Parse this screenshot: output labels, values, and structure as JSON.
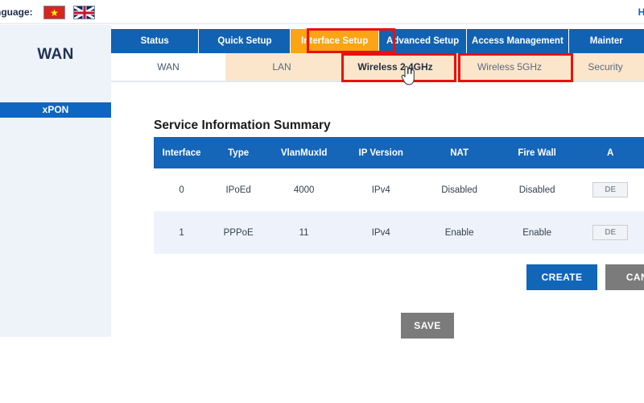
{
  "topbar": {
    "language_label": "nguage:",
    "flags": [
      {
        "name": "vietnam-flag",
        "title": "Vietnamese"
      },
      {
        "name": "uk-flag",
        "title": "English"
      }
    ],
    "help_label": "He"
  },
  "sidebar": {
    "title": "WAN",
    "items": [
      {
        "label": "xPON",
        "active": true
      }
    ]
  },
  "nav": {
    "tabs": [
      {
        "label": "Status",
        "active": false
      },
      {
        "label": "Quick Setup",
        "active": false
      },
      {
        "label": "Interface Setup",
        "active": true
      },
      {
        "label": "Advanced Setup",
        "active": false
      },
      {
        "label": "Access Management",
        "active": false
      },
      {
        "label": "Mainter",
        "active": false
      }
    ]
  },
  "subnav": {
    "tabs": [
      {
        "label": "WAN",
        "active": true
      },
      {
        "label": "LAN",
        "active": false
      },
      {
        "label": "Wireless 2.4GHz",
        "active": false,
        "highlighted": true
      },
      {
        "label": "Wireless 5GHz",
        "active": false,
        "highlighted": true
      },
      {
        "label": "Security",
        "active": false
      }
    ]
  },
  "content": {
    "section_title": "Service Information Summary",
    "table": {
      "columns": [
        "Interface",
        "Type",
        "VlanMuxId",
        "IP Version",
        "NAT",
        "Fire Wall",
        "A"
      ],
      "rows": [
        {
          "interface": "0",
          "type": "IPoEd",
          "vlanmuxid": "4000",
          "ip_version": "IPv4",
          "nat": "Disabled",
          "firewall": "Disabled",
          "action_label": "DE"
        },
        {
          "interface": "1",
          "type": "PPPoE",
          "vlanmuxid": "11",
          "ip_version": "IPv4",
          "nat": "Enable",
          "firewall": "Enable",
          "action_label": "DE"
        }
      ]
    },
    "buttons": {
      "create": "CREATE",
      "cancel": "CANC",
      "save": "SAVE"
    }
  },
  "colors": {
    "nav_blue": "#1262b3",
    "active_orange": "#fba415",
    "annotation_red": "#e8110d",
    "table_header_blue": "#1565b8",
    "sidebar_bg": "#eef2f9",
    "subnav_peach": "#fbe6cb",
    "button_gray": "#7b7b7b",
    "button_blue": "#1266b8"
  }
}
